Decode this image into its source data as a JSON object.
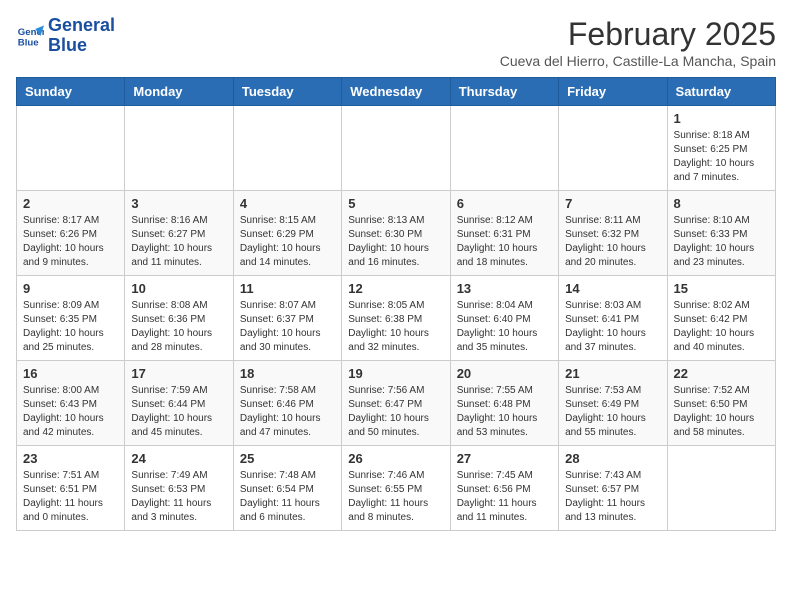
{
  "header": {
    "logo_line1": "General",
    "logo_line2": "Blue",
    "month_title": "February 2025",
    "location": "Cueva del Hierro, Castille-La Mancha, Spain"
  },
  "weekdays": [
    "Sunday",
    "Monday",
    "Tuesday",
    "Wednesday",
    "Thursday",
    "Friday",
    "Saturday"
  ],
  "weeks": [
    [
      {
        "day": "",
        "info": ""
      },
      {
        "day": "",
        "info": ""
      },
      {
        "day": "",
        "info": ""
      },
      {
        "day": "",
        "info": ""
      },
      {
        "day": "",
        "info": ""
      },
      {
        "day": "",
        "info": ""
      },
      {
        "day": "1",
        "info": "Sunrise: 8:18 AM\nSunset: 6:25 PM\nDaylight: 10 hours and 7 minutes."
      }
    ],
    [
      {
        "day": "2",
        "info": "Sunrise: 8:17 AM\nSunset: 6:26 PM\nDaylight: 10 hours and 9 minutes."
      },
      {
        "day": "3",
        "info": "Sunrise: 8:16 AM\nSunset: 6:27 PM\nDaylight: 10 hours and 11 minutes."
      },
      {
        "day": "4",
        "info": "Sunrise: 8:15 AM\nSunset: 6:29 PM\nDaylight: 10 hours and 14 minutes."
      },
      {
        "day": "5",
        "info": "Sunrise: 8:13 AM\nSunset: 6:30 PM\nDaylight: 10 hours and 16 minutes."
      },
      {
        "day": "6",
        "info": "Sunrise: 8:12 AM\nSunset: 6:31 PM\nDaylight: 10 hours and 18 minutes."
      },
      {
        "day": "7",
        "info": "Sunrise: 8:11 AM\nSunset: 6:32 PM\nDaylight: 10 hours and 20 minutes."
      },
      {
        "day": "8",
        "info": "Sunrise: 8:10 AM\nSunset: 6:33 PM\nDaylight: 10 hours and 23 minutes."
      }
    ],
    [
      {
        "day": "9",
        "info": "Sunrise: 8:09 AM\nSunset: 6:35 PM\nDaylight: 10 hours and 25 minutes."
      },
      {
        "day": "10",
        "info": "Sunrise: 8:08 AM\nSunset: 6:36 PM\nDaylight: 10 hours and 28 minutes."
      },
      {
        "day": "11",
        "info": "Sunrise: 8:07 AM\nSunset: 6:37 PM\nDaylight: 10 hours and 30 minutes."
      },
      {
        "day": "12",
        "info": "Sunrise: 8:05 AM\nSunset: 6:38 PM\nDaylight: 10 hours and 32 minutes."
      },
      {
        "day": "13",
        "info": "Sunrise: 8:04 AM\nSunset: 6:40 PM\nDaylight: 10 hours and 35 minutes."
      },
      {
        "day": "14",
        "info": "Sunrise: 8:03 AM\nSunset: 6:41 PM\nDaylight: 10 hours and 37 minutes."
      },
      {
        "day": "15",
        "info": "Sunrise: 8:02 AM\nSunset: 6:42 PM\nDaylight: 10 hours and 40 minutes."
      }
    ],
    [
      {
        "day": "16",
        "info": "Sunrise: 8:00 AM\nSunset: 6:43 PM\nDaylight: 10 hours and 42 minutes."
      },
      {
        "day": "17",
        "info": "Sunrise: 7:59 AM\nSunset: 6:44 PM\nDaylight: 10 hours and 45 minutes."
      },
      {
        "day": "18",
        "info": "Sunrise: 7:58 AM\nSunset: 6:46 PM\nDaylight: 10 hours and 47 minutes."
      },
      {
        "day": "19",
        "info": "Sunrise: 7:56 AM\nSunset: 6:47 PM\nDaylight: 10 hours and 50 minutes."
      },
      {
        "day": "20",
        "info": "Sunrise: 7:55 AM\nSunset: 6:48 PM\nDaylight: 10 hours and 53 minutes."
      },
      {
        "day": "21",
        "info": "Sunrise: 7:53 AM\nSunset: 6:49 PM\nDaylight: 10 hours and 55 minutes."
      },
      {
        "day": "22",
        "info": "Sunrise: 7:52 AM\nSunset: 6:50 PM\nDaylight: 10 hours and 58 minutes."
      }
    ],
    [
      {
        "day": "23",
        "info": "Sunrise: 7:51 AM\nSunset: 6:51 PM\nDaylight: 11 hours and 0 minutes."
      },
      {
        "day": "24",
        "info": "Sunrise: 7:49 AM\nSunset: 6:53 PM\nDaylight: 11 hours and 3 minutes."
      },
      {
        "day": "25",
        "info": "Sunrise: 7:48 AM\nSunset: 6:54 PM\nDaylight: 11 hours and 6 minutes."
      },
      {
        "day": "26",
        "info": "Sunrise: 7:46 AM\nSunset: 6:55 PM\nDaylight: 11 hours and 8 minutes."
      },
      {
        "day": "27",
        "info": "Sunrise: 7:45 AM\nSunset: 6:56 PM\nDaylight: 11 hours and 11 minutes."
      },
      {
        "day": "28",
        "info": "Sunrise: 7:43 AM\nSunset: 6:57 PM\nDaylight: 11 hours and 13 minutes."
      },
      {
        "day": "",
        "info": ""
      }
    ]
  ]
}
